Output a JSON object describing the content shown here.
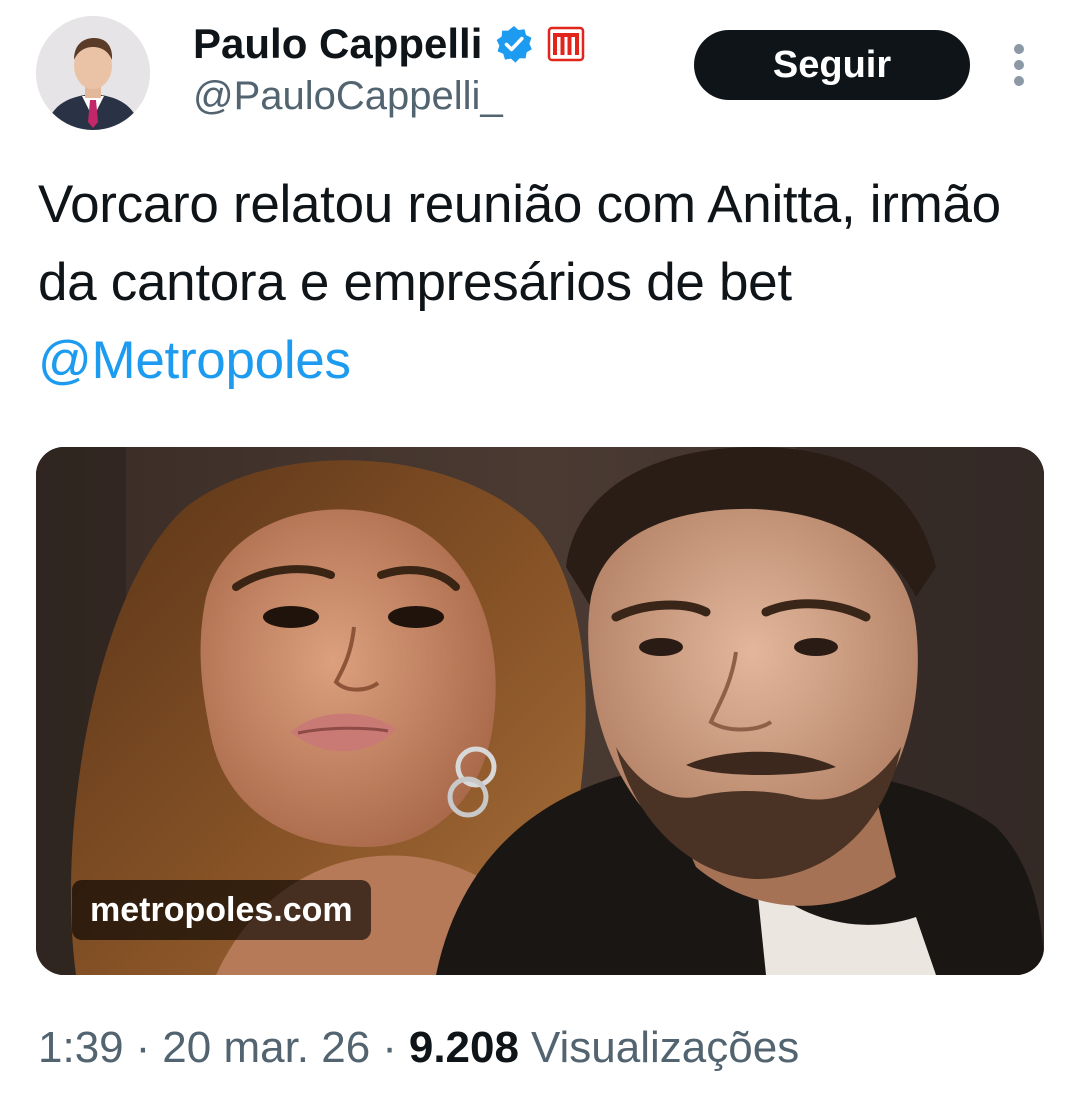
{
  "author": {
    "display_name": "Paulo Cappelli",
    "handle": "@PauloCappelli_",
    "verified_icon": "verified-badge-icon",
    "affiliate_icon": "metropoles-affiliate-icon",
    "avatar_icon": "profile-avatar"
  },
  "follow_button": {
    "label": "Seguir"
  },
  "more_options_icon": "more-vertical-icon",
  "tweet": {
    "text": "Vorcaro relatou reunião com Anitta, irmão da cantora e empresários de bet",
    "mention": "@Metropoles"
  },
  "media": {
    "link_domain": "metropoles.com"
  },
  "meta": {
    "time": "1:39",
    "separator": "·",
    "date": "20 mar. 26",
    "views_count": "9.208",
    "views_label": "Visualizações"
  },
  "colors": {
    "accent": "#1d9bf0",
    "text_primary": "#0f1419",
    "text_secondary": "#536471",
    "button_bg": "#0f1419",
    "affiliate_red": "#e1251b"
  }
}
